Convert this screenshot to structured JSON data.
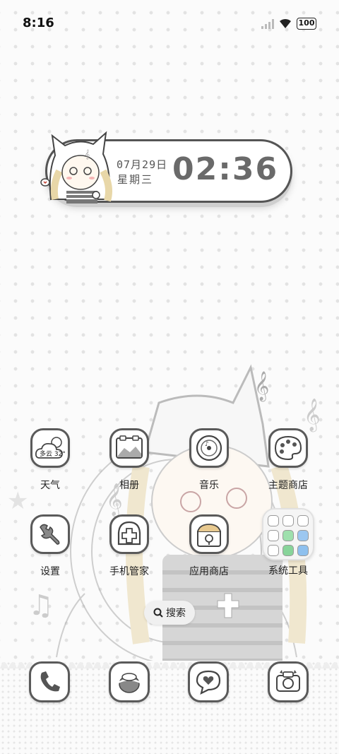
{
  "status_bar": {
    "time": "8:16",
    "battery": "100"
  },
  "clock_widget": {
    "date": "07月29日",
    "weekday": "星期三",
    "time": "02:36"
  },
  "apps": [
    {
      "label": "天气",
      "icon": "weather-icon",
      "weather_text": "多云 32°"
    },
    {
      "label": "相册",
      "icon": "gallery-icon"
    },
    {
      "label": "音乐",
      "icon": "music-icon"
    },
    {
      "label": "主题商店",
      "icon": "palette-icon"
    },
    {
      "label": "设置",
      "icon": "wrench-icon"
    },
    {
      "label": "手机管家",
      "icon": "security-icon"
    },
    {
      "label": "应用商店",
      "icon": "app-store-icon"
    },
    {
      "label": "系统工具",
      "icon": "folder-icon"
    }
  ],
  "search": {
    "label": "搜索"
  },
  "dock": [
    {
      "icon": "phone-icon"
    },
    {
      "icon": "browser-icon"
    },
    {
      "icon": "messages-icon"
    },
    {
      "icon": "camera-icon"
    }
  ]
}
